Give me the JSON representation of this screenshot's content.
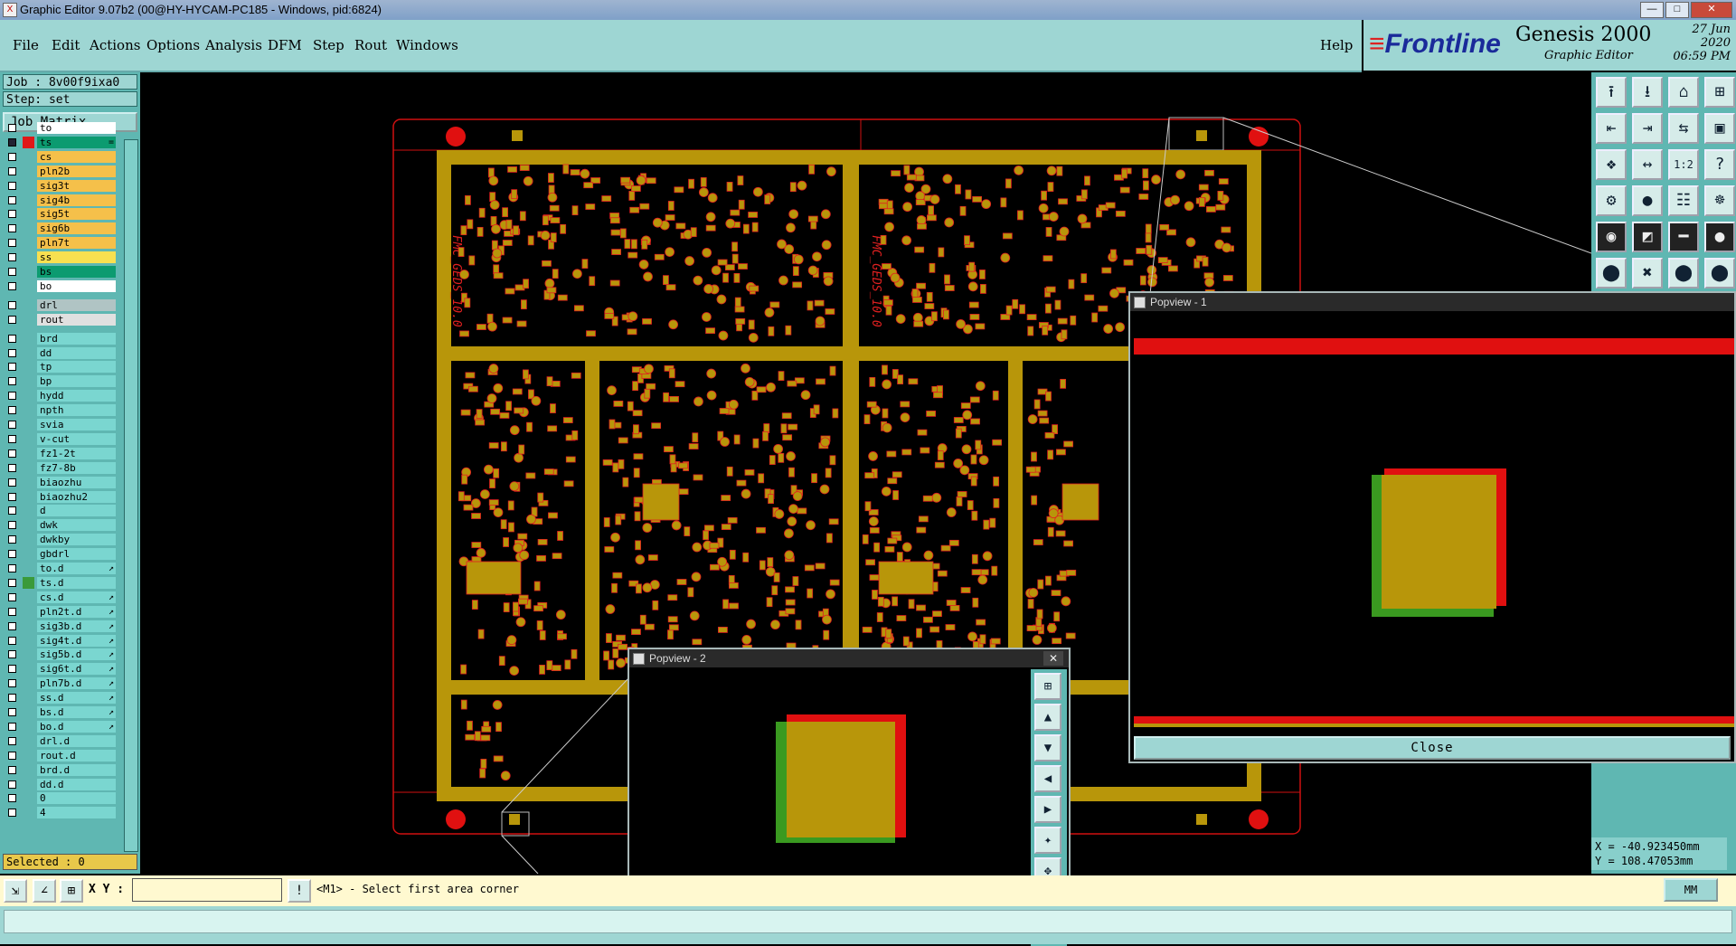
{
  "window": {
    "title": "Graphic Editor 9.07b2 (00@HY-HYCAM-PC185 - Windows, pid:6824)",
    "app_icon": "X"
  },
  "menu": [
    "File",
    "Edit",
    "Actions",
    "Options",
    "Analysis",
    "DFM",
    "Step",
    "Rout",
    "Windows"
  ],
  "help_label": "Help",
  "brand": {
    "logo": "Frontline",
    "product": "Genesis 2000",
    "subtitle": "Graphic Editor",
    "date": "27 Jun 2020",
    "time": "06:59 PM"
  },
  "job": {
    "job_line": "Job : 8v00f9ixa0",
    "step_line": "Step: set",
    "matrix_button": "Job Matrix ..."
  },
  "layers": [
    {
      "name": "to",
      "color": "#ffffff",
      "checked": false,
      "marker": "",
      "tick": ""
    },
    {
      "name": "ts",
      "color": "#0c9b70",
      "checked": true,
      "marker": "#e01818",
      "tick": "="
    },
    {
      "name": "cs",
      "color": "#f5c04a",
      "checked": false,
      "marker": "",
      "tick": ""
    },
    {
      "name": "pln2b",
      "color": "#f5c04a",
      "checked": false,
      "marker": "",
      "tick": ""
    },
    {
      "name": "sig3t",
      "color": "#f5c04a",
      "checked": false,
      "marker": "",
      "tick": ""
    },
    {
      "name": "sig4b",
      "color": "#f5c04a",
      "checked": false,
      "marker": "",
      "tick": ""
    },
    {
      "name": "sig5t",
      "color": "#f5c04a",
      "checked": false,
      "marker": "",
      "tick": ""
    },
    {
      "name": "sig6b",
      "color": "#f5c04a",
      "checked": false,
      "marker": "",
      "tick": ""
    },
    {
      "name": "pln7t",
      "color": "#f5c04a",
      "checked": false,
      "marker": "",
      "tick": ""
    },
    {
      "name": "ss",
      "color": "#f8e050",
      "checked": false,
      "marker": "",
      "tick": ""
    },
    {
      "name": "bs",
      "color": "#0c9b70",
      "checked": false,
      "marker": "",
      "tick": ""
    },
    {
      "name": "bo",
      "color": "#ffffff",
      "checked": false,
      "marker": "",
      "tick": ""
    },
    {
      "name": "drl",
      "color": "#b0c4c4",
      "checked": false,
      "marker": "",
      "tick": ""
    },
    {
      "name": "rout",
      "color": "#e0e0e0",
      "checked": false,
      "marker": "",
      "tick": ""
    },
    {
      "name": "brd",
      "color": "#7ad6d0",
      "checked": false,
      "marker": "",
      "tick": ""
    },
    {
      "name": "dd",
      "color": "#7ad6d0",
      "checked": false,
      "marker": "",
      "tick": ""
    },
    {
      "name": "tp",
      "color": "#7ad6d0",
      "checked": false,
      "marker": "",
      "tick": ""
    },
    {
      "name": "bp",
      "color": "#7ad6d0",
      "checked": false,
      "marker": "",
      "tick": ""
    },
    {
      "name": "hydd",
      "color": "#7ad6d0",
      "checked": false,
      "marker": "",
      "tick": ""
    },
    {
      "name": "npth",
      "color": "#7ad6d0",
      "checked": false,
      "marker": "",
      "tick": ""
    },
    {
      "name": "svia",
      "color": "#7ad6d0",
      "checked": false,
      "marker": "",
      "tick": ""
    },
    {
      "name": "v-cut",
      "color": "#7ad6d0",
      "checked": false,
      "marker": "",
      "tick": ""
    },
    {
      "name": "fz1-2t",
      "color": "#7ad6d0",
      "checked": false,
      "marker": "",
      "tick": ""
    },
    {
      "name": "fz7-8b",
      "color": "#7ad6d0",
      "checked": false,
      "marker": "",
      "tick": ""
    },
    {
      "name": "biaozhu",
      "color": "#7ad6d0",
      "checked": false,
      "marker": "",
      "tick": ""
    },
    {
      "name": "biaozhu2",
      "color": "#7ad6d0",
      "checked": false,
      "marker": "",
      "tick": ""
    },
    {
      "name": "d",
      "color": "#7ad6d0",
      "checked": false,
      "marker": "",
      "tick": ""
    },
    {
      "name": "dwk",
      "color": "#7ad6d0",
      "checked": false,
      "marker": "",
      "tick": ""
    },
    {
      "name": "dwkby",
      "color": "#7ad6d0",
      "checked": false,
      "marker": "",
      "tick": ""
    },
    {
      "name": "gbdrl",
      "color": "#7ad6d0",
      "checked": false,
      "marker": "",
      "tick": ""
    },
    {
      "name": "to.d",
      "color": "#7ad6d0",
      "checked": false,
      "marker": "",
      "tick": "↗"
    },
    {
      "name": "ts.d",
      "color": "#7ad6d0",
      "checked": false,
      "marker": "#3a9a3a",
      "tick": ""
    },
    {
      "name": "cs.d",
      "color": "#7ad6d0",
      "checked": false,
      "marker": "",
      "tick": "↗"
    },
    {
      "name": "pln2t.d",
      "color": "#7ad6d0",
      "checked": false,
      "marker": "",
      "tick": "↗"
    },
    {
      "name": "sig3b.d",
      "color": "#7ad6d0",
      "checked": false,
      "marker": "",
      "tick": "↗"
    },
    {
      "name": "sig4t.d",
      "color": "#7ad6d0",
      "checked": false,
      "marker": "",
      "tick": "↗"
    },
    {
      "name": "sig5b.d",
      "color": "#7ad6d0",
      "checked": false,
      "marker": "",
      "tick": "↗"
    },
    {
      "name": "sig6t.d",
      "color": "#7ad6d0",
      "checked": false,
      "marker": "",
      "tick": "↗"
    },
    {
      "name": "pln7b.d",
      "color": "#7ad6d0",
      "checked": false,
      "marker": "",
      "tick": "↗"
    },
    {
      "name": "ss.d",
      "color": "#7ad6d0",
      "checked": false,
      "marker": "",
      "tick": "↗"
    },
    {
      "name": "bs.d",
      "color": "#7ad6d0",
      "checked": false,
      "marker": "",
      "tick": "↗"
    },
    {
      "name": "bo.d",
      "color": "#7ad6d0",
      "checked": false,
      "marker": "",
      "tick": "↗"
    },
    {
      "name": "drl.d",
      "color": "#7ad6d0",
      "checked": false,
      "marker": "",
      "tick": ""
    },
    {
      "name": "rout.d",
      "color": "#7ad6d0",
      "checked": false,
      "marker": "",
      "tick": ""
    },
    {
      "name": "brd.d",
      "color": "#7ad6d0",
      "checked": false,
      "marker": "",
      "tick": ""
    },
    {
      "name": "dd.d",
      "color": "#7ad6d0",
      "checked": false,
      "marker": "",
      "tick": ""
    },
    {
      "name": "0",
      "color": "#7ad6d0",
      "checked": false,
      "marker": "",
      "tick": ""
    },
    {
      "name": "4",
      "color": "#7ad6d0",
      "checked": false,
      "marker": "",
      "tick": ""
    }
  ],
  "selected_label": "Selected : 0",
  "status": {
    "xy_label": "X Y :",
    "xy_value": "",
    "prompt": "<M1> - Select first area corner",
    "units": "MM"
  },
  "coords": {
    "x": "X = -40.923450mm",
    "y": "Y = 108.47053mm"
  },
  "popview1": {
    "title": "Popview - 1",
    "close_label": "Close"
  },
  "popview2": {
    "title": "Popview - 2",
    "close_glyph": "✕"
  },
  "colors": {
    "copper": "#b8960a",
    "copper_edge": "#e02020",
    "profile": "#d01010",
    "panel_bg": "#5fb7b2",
    "menu_bg": "#9ed6d3"
  },
  "tool_icons": [
    "zoom-home-icon",
    "zoom-back-icon",
    "home-icon",
    "grid-icon",
    "pan-left-icon",
    "pan-right-icon",
    "pan-up-icon",
    "fit-icon",
    "fit-screen-icon",
    "zoom-fit-icon",
    "scale-1to2-icon",
    "help-icon",
    "snap-icon",
    "measure-icon",
    "layers-icon",
    "layers2-icon",
    "select-icon",
    "profile-icon",
    "ruler-icon",
    "circle-icon",
    "connect-icon",
    "cross-icon",
    "route-icon",
    "route2-icon"
  ]
}
